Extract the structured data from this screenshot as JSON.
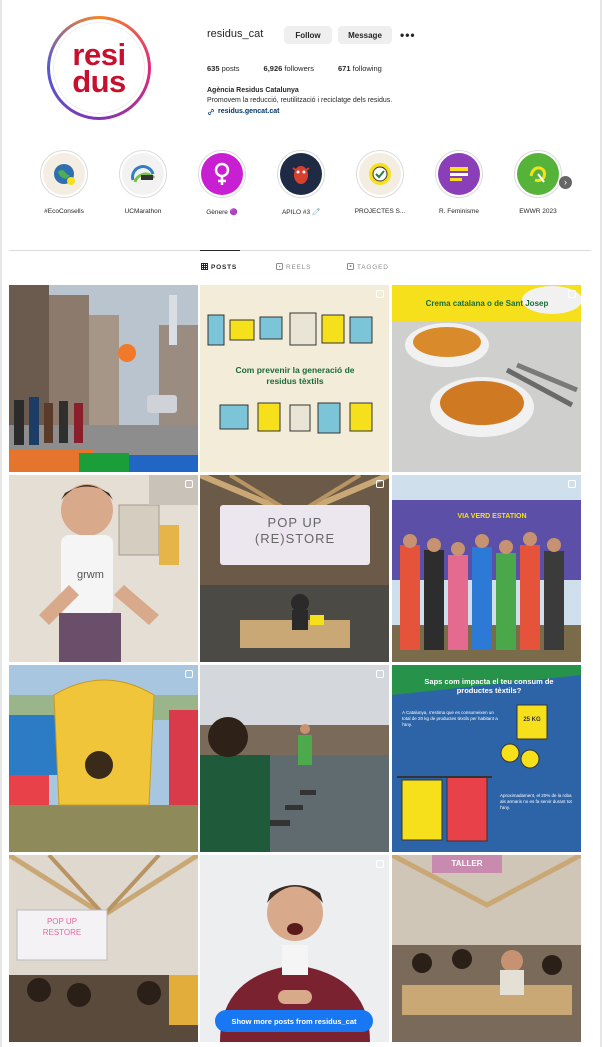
{
  "profile": {
    "username": "residus_cat",
    "logo_line1": "resi",
    "logo_line2": "dus",
    "follow_label": "Follow",
    "message_label": "Message",
    "more_label": "•••",
    "stats": [
      {
        "count": "635",
        "label": "posts"
      },
      {
        "count": "6,926",
        "label": "followers"
      },
      {
        "count": "671",
        "label": "following"
      }
    ],
    "bio_name": "Agència Residus Catalunya",
    "bio_text": "Promovem la reducció, reutilització i reciclatge dels residus.",
    "bio_link": "residus.gencat.cat"
  },
  "highlights": [
    {
      "label": "#EcoConsells",
      "color": "#f3ede2",
      "icon": "globe-icon"
    },
    {
      "label": "UCMarathon",
      "color": "#f2f2f2",
      "icon": "marathon-logo-icon"
    },
    {
      "label": "Gènere 🟣",
      "color": "#c81fd2",
      "icon": "female-symbol-icon"
    },
    {
      "label": "APILO #3 🧷",
      "color": "#1f2a44",
      "icon": "creature-icon"
    },
    {
      "label": "PROJECTES S...",
      "color": "#f3ede2",
      "icon": "badge-icon"
    },
    {
      "label": "R. Feminisme",
      "color": "#8a3fb8",
      "icon": "poster-icon"
    },
    {
      "label": "EWWR 2023",
      "color": "#56b33a",
      "icon": "ewwr-logo-icon"
    }
  ],
  "tabs": [
    {
      "label": "POSTS",
      "icon": "grid-icon"
    },
    {
      "label": "REELS",
      "icon": "reels-icon"
    },
    {
      "label": "TAGGED",
      "icon": "tagged-icon"
    }
  ],
  "posts": {
    "tile2_title": "Com prevenir la generació de residus tèxtils",
    "tile3_title": "Crema catalana o de Sant Josep",
    "tile4_caption": "grwm",
    "tile5_sign_line1": "POP UP",
    "tile5_sign_line2": "(RE)STORE",
    "tile6_banner": "VIA VERD ESTATION",
    "tile9_title": "Saps com impacta el teu consum de productes tèxtils?",
    "tile9_badge": "25 KG",
    "tile9_body": "A Catalunya, s'estima que es consumeixen un total de 20 kg de productes tèxtils per habitant a l'any.",
    "tile9_body2": "Aproximadament, el 20% de la roba als armaris no es fa servir durant tot l'any.",
    "tile10_sign_line1": "POP UP",
    "tile10_sign_line2": "RESTORE",
    "tile12_sign": "TALLER"
  },
  "show_more_label": "Show more posts from residus_cat",
  "colors": {
    "brand_red": "#c8102e",
    "link_blue": "#00376b",
    "button_blue": "#1877f2",
    "yellow": "#f6e01c"
  }
}
